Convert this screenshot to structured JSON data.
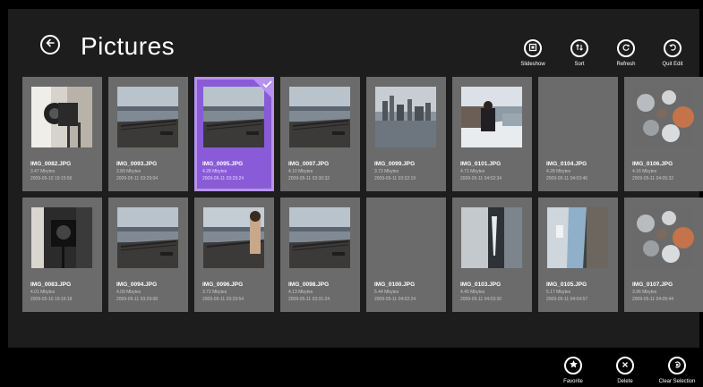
{
  "header": {
    "title": "Pictures",
    "back_icon": "back-arrow-icon"
  },
  "app_bar_top": [
    {
      "label": "Slideshow",
      "icon": "slideshow-icon"
    },
    {
      "label": "Sort",
      "icon": "sort-icon"
    },
    {
      "label": "Refresh",
      "icon": "refresh-icon"
    },
    {
      "label": "Quit Edit",
      "icon": "quit-edit-icon"
    }
  ],
  "tiles": [
    {
      "name": "IMG_0082.JPG",
      "size": "3.47 Mbytes",
      "date": "2009-05-10 19:15:56",
      "scene": "camera",
      "selected": false
    },
    {
      "name": "IMG_0093.JPG",
      "size": "3.89 Mbytes",
      "date": "2009-05-11 03:29:04",
      "scene": "waterfront",
      "selected": false
    },
    {
      "name": "IMG_0095.JPG",
      "size": "4.28 Mbytes",
      "date": "2009-05-11 03:29:24",
      "scene": "waterfront",
      "selected": true
    },
    {
      "name": "IMG_0097.JPG",
      "size": "4.10 Mbytes",
      "date": "2009-05-11 03:30:32",
      "scene": "waterfront",
      "selected": false
    },
    {
      "name": "IMG_0099.JPG",
      "size": "3.72 Mbytes",
      "date": "2009-05-11 03:32:19",
      "scene": "skyline",
      "selected": false
    },
    {
      "name": "IMG_0101.JPG",
      "size": "4.71 Mbytes",
      "date": "2009-05-11 04:02:34",
      "scene": "snow-person",
      "selected": false
    },
    {
      "name": "IMG_0104.JPG",
      "size": "4.28 Mbytes",
      "date": "2009-05-11 04:03:46",
      "scene": "none",
      "selected": false
    },
    {
      "name": "IMG_0106.JPG",
      "size": "4.16 Mbytes",
      "date": "2009-05-11 04:05:32",
      "scene": "leaves",
      "selected": false
    },
    {
      "name": "IMG_0083.JPG",
      "size": "4.01 Mbytes",
      "date": "2009-05-10 19:16:18",
      "scene": "camera-dark",
      "selected": false
    },
    {
      "name": "IMG_0094.JPG",
      "size": "4.09 Mbytes",
      "date": "2009-05-11 03:29:08",
      "scene": "waterfront",
      "selected": false
    },
    {
      "name": "IMG_0096.JPG",
      "size": "3.72 Mbytes",
      "date": "2009-05-11 03:29:54",
      "scene": "waterfront-person",
      "selected": false
    },
    {
      "name": "IMG_0098.JPG",
      "size": "4.13 Mbytes",
      "date": "2009-05-11 03:31:24",
      "scene": "waterfront",
      "selected": false
    },
    {
      "name": "IMG_0100.JPG",
      "size": "5.44 Mbytes",
      "date": "2009-05-11 04:02:24",
      "scene": "none",
      "selected": false
    },
    {
      "name": "IMG_0103.JPG",
      "size": "4.45 Mbytes",
      "date": "2009-05-11 04:03:30",
      "scene": "icicle",
      "selected": false
    },
    {
      "name": "IMG_0105.JPG",
      "size": "5.17 Mbytes",
      "date": "2009-05-11 04:04:57",
      "scene": "ice",
      "selected": false
    },
    {
      "name": "IMG_0107.JPG",
      "size": "3.96 Mbytes",
      "date": "2009-05-11 04:05:44",
      "scene": "leaves",
      "selected": false
    }
  ],
  "app_bar_bottom": [
    {
      "label": "Favorite",
      "icon": "star-icon"
    },
    {
      "label": "Delete",
      "icon": "delete-icon"
    },
    {
      "label": "Clear Selection",
      "icon": "clear-selection-icon"
    }
  ],
  "colors": {
    "background": "#1d1d1d",
    "tile": "#6b6b6b",
    "selected_tile": "#8a5bd8",
    "selected_border": "#b892f0"
  }
}
